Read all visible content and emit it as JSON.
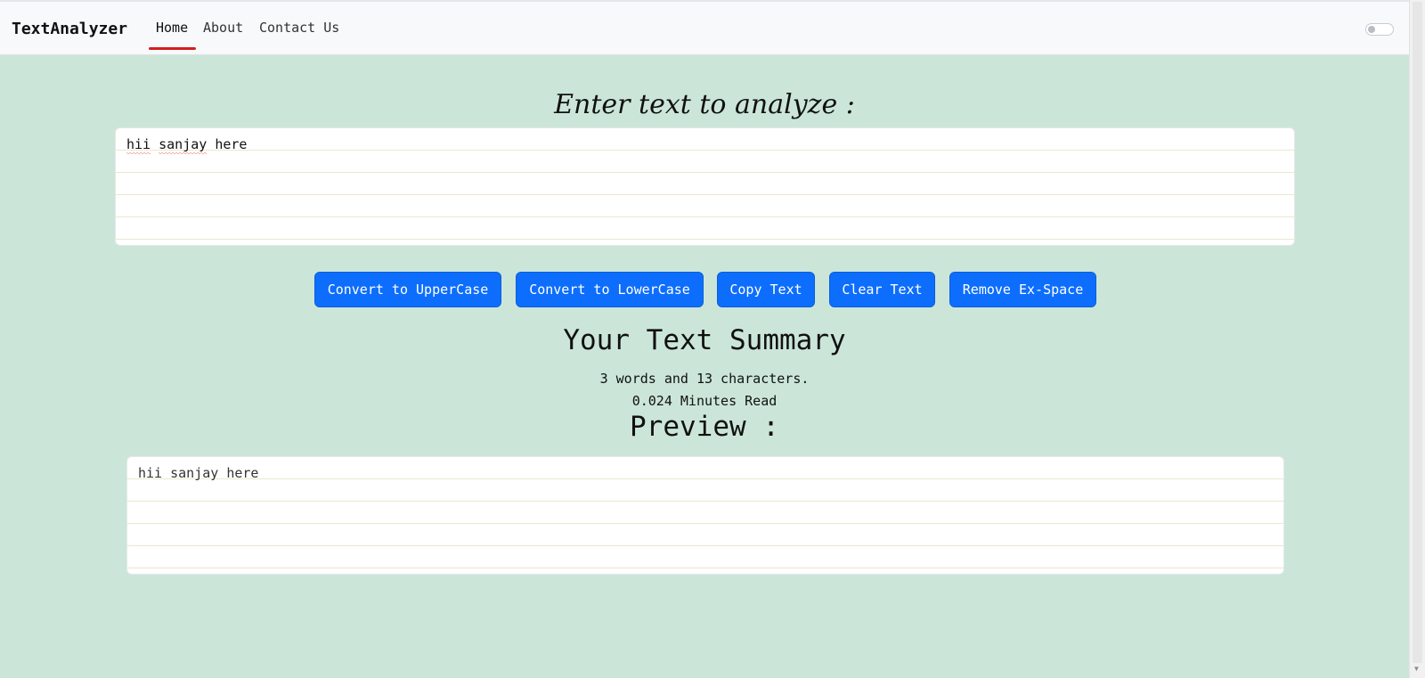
{
  "navbar": {
    "brand": "TextAnalyzer",
    "links": [
      {
        "label": "Home",
        "active": true
      },
      {
        "label": "About",
        "active": false
      },
      {
        "label": "Contact Us",
        "active": false
      }
    ],
    "active_indicator_color": "#d21f1f",
    "dark_mode_toggle": {
      "on": false
    }
  },
  "main": {
    "heading": "Enter text to analyze :",
    "input": {
      "word1": "hii",
      "word2": "sanjay",
      "word3": "here",
      "misspelled": [
        "hii",
        "sanjay"
      ]
    },
    "buttons": [
      {
        "label": "Convert to UpperCase"
      },
      {
        "label": "Convert to LowerCase"
      },
      {
        "label": "Copy Text"
      },
      {
        "label": "Clear Text"
      },
      {
        "label": "Remove Ex-Space"
      }
    ],
    "summary": {
      "title": "Your Text Summary",
      "counts": "3 words and 13 characters.",
      "read_time": "0.024 Minutes Read"
    },
    "preview": {
      "title": "Preview :",
      "text": "hii sanjay here"
    }
  },
  "colors": {
    "background": "#cbe6d9",
    "navbar": "#f8f9fb",
    "button": "#0d6efd",
    "button_text": "#ffffff",
    "paper_line": "#ece7cf"
  }
}
